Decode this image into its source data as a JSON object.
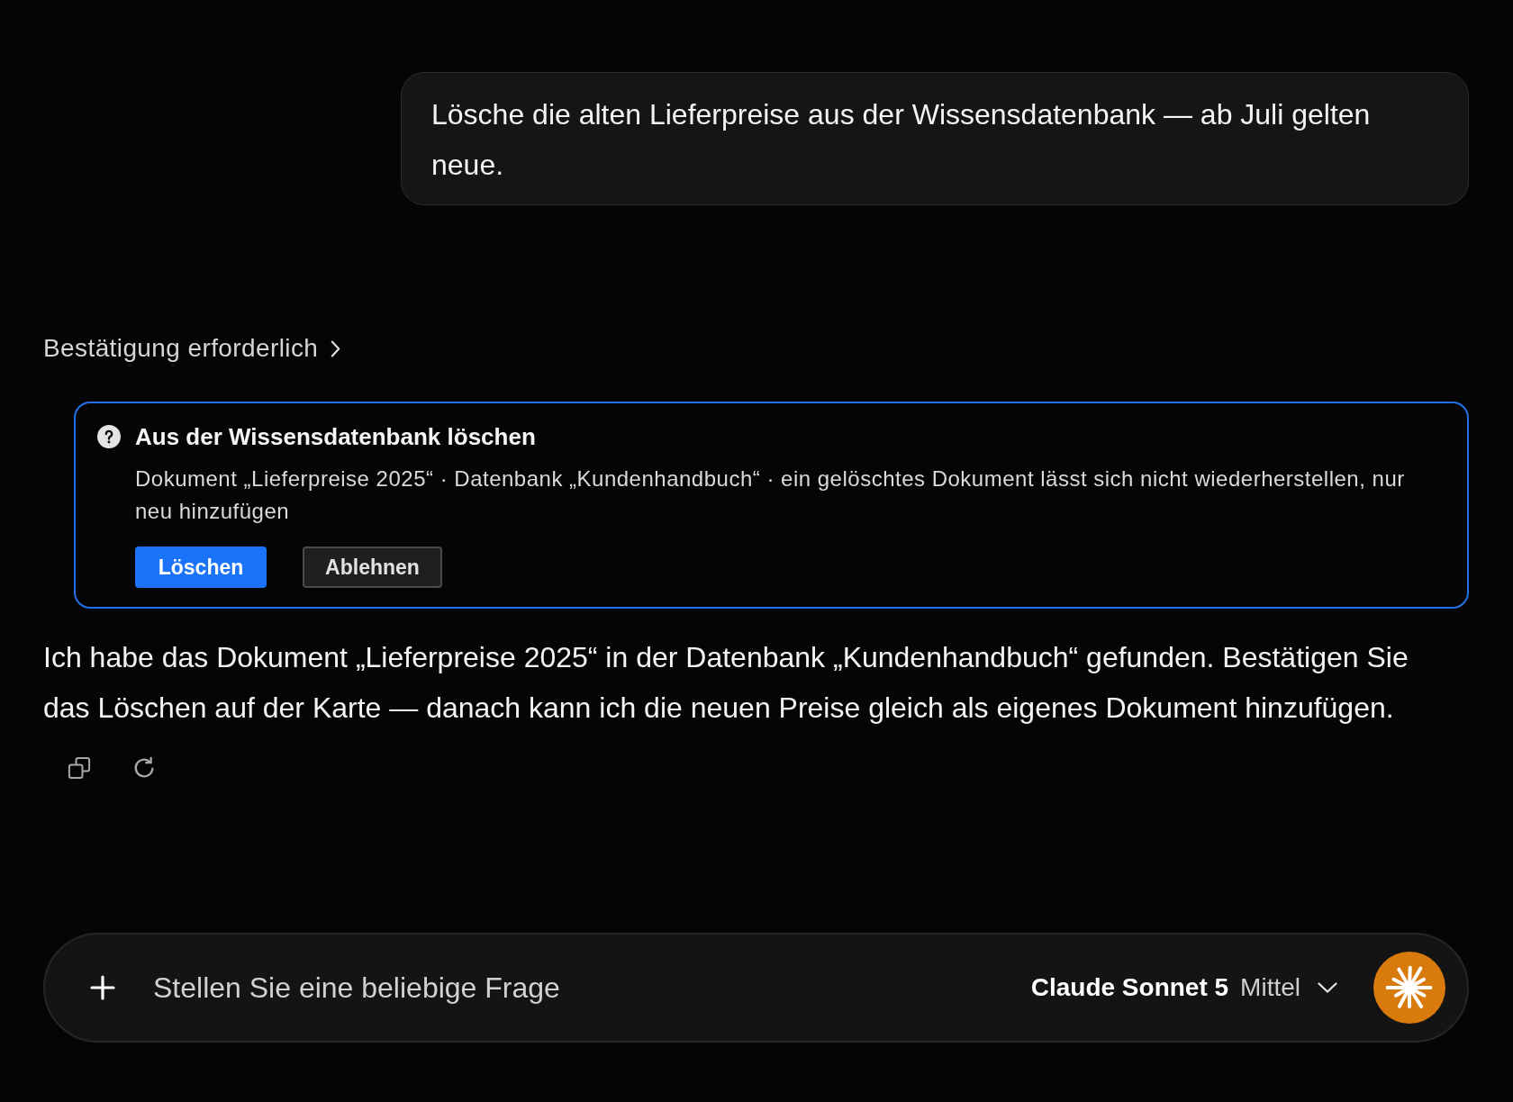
{
  "user_message": {
    "text": "Lösche die alten Lieferpreise aus der Wissensdatenbank — ab Juli gelten neue."
  },
  "tool_status": {
    "label": "Bestätigung erforderlich",
    "expanded": false
  },
  "confirmation_card": {
    "title": "Aus der Wissensdatenbank löschen",
    "description": "Dokument „Lieferpreise 2025“ · Datenbank „Kundenhandbuch“ · ein gelöschtes Dokument lässt sich nicht wiederherstellen, nur neu hinzufügen",
    "buttons": [
      {
        "label": "Löschen",
        "kind": "primary"
      },
      {
        "label": "Ablehnen",
        "kind": "secondary"
      }
    ]
  },
  "assistant_message": {
    "text": "Ich habe das Dokument „Lieferpreise 2025“ in der Datenbank „Kundenhandbuch“ gefunden. Bestätigen Sie das Löschen auf der Karte — danach kann ich die neuen Preise gleich als eigenes Dokument hinzufügen."
  },
  "composer": {
    "placeholder": "Stellen Sie eine beliebige Frage",
    "model": "Claude Sonnet 5",
    "effort": "Mittel"
  }
}
